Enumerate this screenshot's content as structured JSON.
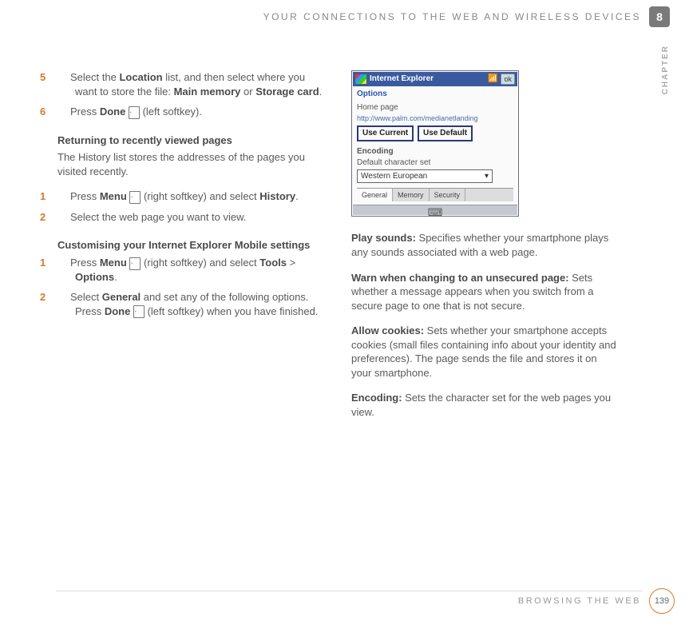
{
  "header": {
    "running": "YOUR CONNECTIONS TO THE WEB AND WIRELESS DEVICES",
    "chapter_number": "8",
    "chapter_label": "CHAPTER"
  },
  "footer": {
    "section": "BROWSING THE WEB",
    "page": "139"
  },
  "softkey_glyph": "· · ·",
  "left": {
    "step5": {
      "n": "5",
      "t1": "Select the ",
      "b1": "Location",
      "t2": " list, and then select where you want to store the file: ",
      "b2": "Main memory",
      "t3": " or ",
      "b3": "Storage card",
      "t4": "."
    },
    "step6": {
      "n": "6",
      "t1": "Press ",
      "b1": "Done",
      "t2": " (left softkey)."
    },
    "secA_title": "Returning to recently viewed pages",
    "secA_body": "The History list stores the addresses of the pages you visited recently.",
    "secA_s1": {
      "n": "1",
      "t1": "Press ",
      "b1": "Menu",
      "t2": " (right softkey) and select ",
      "b2": "History",
      "t3": "."
    },
    "secA_s2": {
      "n": "2",
      "t1": "Select the web page you want to view."
    },
    "secB_title": "Customising your Internet Explorer Mobile settings",
    "secB_s1": {
      "n": "1",
      "t1": "Press ",
      "b1": "Menu",
      "t2": " (right softkey) and select ",
      "b2": "Tools",
      "t3": " > ",
      "b3": "Options",
      "t4": "."
    },
    "secB_s2": {
      "n": "2",
      "t1": "Select ",
      "b1": "General",
      "t2": " and set any of the following options. Press ",
      "b2": "Done",
      "t3": " (left softkey) when you have finished."
    }
  },
  "screenshot": {
    "titlebar": "Internet Explorer",
    "ok": "ok",
    "options_label": "Options",
    "homepage_label": "Home page",
    "homepage_url": "http://www.palm.com/medianetlanding",
    "btn_use_current": "Use Current",
    "btn_use_default": "Use Default",
    "encoding_label": "Encoding",
    "charset_label": "Default character set",
    "charset_value": "Western European",
    "tabs": {
      "general": "General",
      "memory": "Memory",
      "security": "Security"
    }
  },
  "right": {
    "p1": {
      "b": "Play sounds:",
      "t": " Specifies whether your smartphone plays any sounds associated with a web page."
    },
    "p2": {
      "b": "Warn when changing to an unsecured page:",
      "t": " Sets whether a message appears when you switch from a secure page to one that is not secure."
    },
    "p3": {
      "b": "Allow cookies:",
      "t": " Sets whether your smartphone accepts cookies (small files containing info about your identity and preferences). The page sends the file and stores it on your smartphone."
    },
    "p4": {
      "b": "Encoding:",
      "t": " Sets the character set for the web pages you view."
    }
  }
}
